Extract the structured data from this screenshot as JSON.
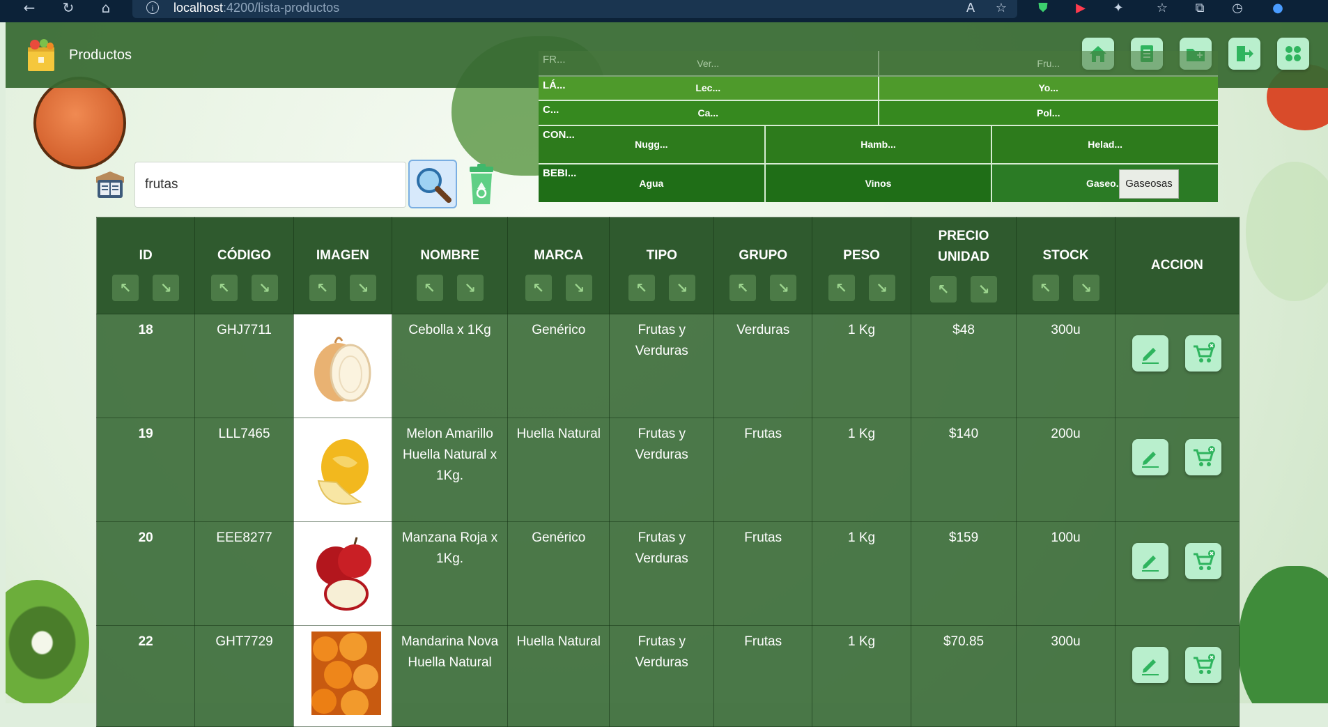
{
  "browser": {
    "url_host": "localhost",
    "url_path": ":4200/lista-productos"
  },
  "header": {
    "title": "Productos"
  },
  "menu": {
    "rows": [
      {
        "label": "FR...",
        "items": [
          "Ver...",
          "Fru..."
        ]
      },
      {
        "label": "LÁ...",
        "items": [
          "Lec...",
          "Yo..."
        ]
      },
      {
        "label": "C...",
        "items": [
          "Ca...",
          "Pol..."
        ]
      },
      {
        "label": "CON...",
        "items": [
          "Nugg...",
          "Hamb...",
          "Helad..."
        ]
      },
      {
        "label": "BEBI...",
        "items": [
          "Agua",
          "Vinos",
          "Gaseo..."
        ]
      }
    ],
    "tooltip": "Gaseosas"
  },
  "search": {
    "value": "frutas"
  },
  "table": {
    "columns": [
      "ID",
      "CÓDIGO",
      "IMAGEN",
      "NOMBRE",
      "MARCA",
      "TIPO",
      "GRUPO",
      "PESO",
      "PRECIO UNIDAD",
      "STOCK",
      "ACCION"
    ],
    "rows": [
      {
        "id": "18",
        "codigo": "GHJ7711",
        "nombre": "Cebolla x 1Kg",
        "marca": "Genérico",
        "tipo": "Frutas y Verduras",
        "grupo": "Verduras",
        "peso": "1 Kg",
        "precio": "$48",
        "stock": "300u"
      },
      {
        "id": "19",
        "codigo": "LLL7465",
        "nombre": "Melon Amarillo Huella Natural x 1Kg.",
        "marca": "Huella Natural",
        "tipo": "Frutas y Verduras",
        "grupo": "Frutas",
        "peso": "1 Kg",
        "precio": "$140",
        "stock": "200u"
      },
      {
        "id": "20",
        "codigo": "EEE8277",
        "nombre": "Manzana Roja x 1Kg.",
        "marca": "Genérico",
        "tipo": "Frutas y Verduras",
        "grupo": "Frutas",
        "peso": "1 Kg",
        "precio": "$159",
        "stock": "100u"
      },
      {
        "id": "22",
        "codigo": "GHT7729",
        "nombre": "Mandarina Nova Huella Natural",
        "marca": "Huella Natural",
        "tipo": "Frutas y Verduras",
        "grupo": "Frutas",
        "peso": "1 Kg",
        "precio": "$70.85",
        "stock": "300u"
      }
    ]
  },
  "colors": {
    "header_bg": "#376932",
    "table_header_bg": "#2f5a2e",
    "row_bg": "#346632",
    "button_bg": "#b9efcd",
    "menu_dark": "#1f6e17"
  }
}
